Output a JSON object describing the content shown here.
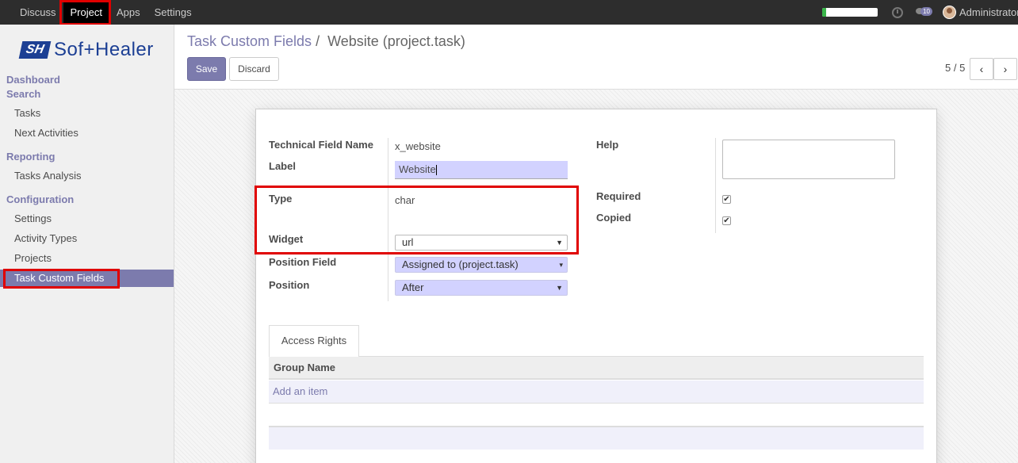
{
  "topbar": {
    "menu": [
      "Discuss",
      "Project",
      "Apps",
      "Settings"
    ],
    "active_index": 1,
    "chat_count": "10",
    "user_name": "Administrator",
    "colors": {
      "background": "#2d2d2d",
      "active": "#000000",
      "progress": "#3ab54a"
    }
  },
  "sidebar": {
    "logo_mark": "SH",
    "logo_text": "Sof+Healer",
    "sections": [
      {
        "title": "Dashboard",
        "items": []
      },
      {
        "title": "Search",
        "items": [
          "Tasks",
          "Next Activities"
        ]
      },
      {
        "title": "Reporting",
        "items": [
          "Tasks Analysis"
        ]
      },
      {
        "title": "Configuration",
        "items": [
          "Settings",
          "Activity Types",
          "Projects",
          "Task Custom Fields"
        ]
      }
    ],
    "active_item": "Task Custom Fields",
    "accent_color": "#7c7bad"
  },
  "control_panel": {
    "breadcrumb_parent": "Task Custom Fields",
    "breadcrumb_separator": "/",
    "breadcrumb_current": "Website (project.task)",
    "save_label": "Save",
    "discard_label": "Discard",
    "pager": "5 / 5",
    "prev_icon": "‹",
    "next_icon": "›"
  },
  "form": {
    "technical_field_name_label": "Technical Field Name",
    "technical_field_name_value": "x_website",
    "label_label": "Label",
    "label_value": "Website",
    "type_label": "Type",
    "type_value": "char",
    "widget_label": "Widget",
    "widget_value": "url",
    "position_field_label": "Position Field",
    "position_field_value": "Assigned to (project.task)",
    "position_label": "Position",
    "position_value": "After",
    "help_label": "Help",
    "required_label": "Required",
    "required_checked": true,
    "copied_label": "Copied",
    "copied_checked": true
  },
  "access_rights": {
    "tab_label": "Access Rights",
    "column_group_name": "Group Name",
    "add_item": "Add an item"
  }
}
